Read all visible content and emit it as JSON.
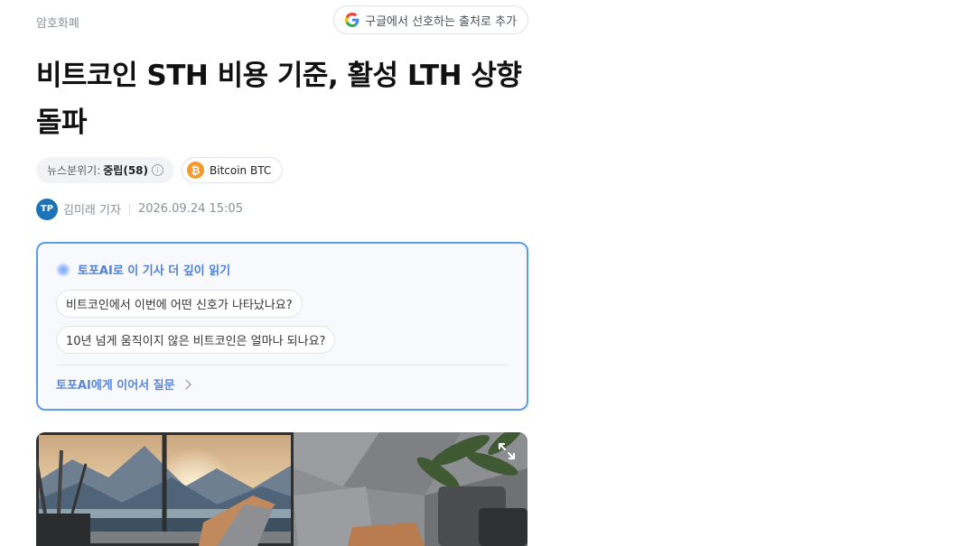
{
  "header": {
    "category": "암호화폐",
    "google_button_label": "구글에서 선호하는 출처로 추가"
  },
  "article": {
    "title": "비트코인 STH 비용 기준, 활성 LTH 상향 돌파",
    "sentiment_label": "뉴스분위기:",
    "sentiment_value": "중립(58)",
    "coin_chip_label": "Bitcoin BTC",
    "author_avatar_text": "TP",
    "author": "김미래 기자",
    "published_at": "2026.09.24 15:05"
  },
  "ai_box": {
    "heading": "토포AI로 이 기사 더 깊이 읽기",
    "questions": [
      "비트코인에서 이번에 어떤 신호가 나타났나요?",
      "10년 넘게 움직이지 않은 비트코인은 얼마나 되나요?"
    ],
    "followup_label": "토포AI에게 이어서 질문"
  },
  "icons": {
    "google": "google-g-icon",
    "info": "info-icon",
    "coin": "bitcoin-icon",
    "ai": "ai-sparkle-icon",
    "chevron": "chevron-right-icon",
    "expand": "expand-icon"
  },
  "colors": {
    "accent": "#5b9ce8",
    "ai_text": "#4f7fd6",
    "bitcoin": "#f39a2b",
    "avatar": "#1e73b8"
  }
}
